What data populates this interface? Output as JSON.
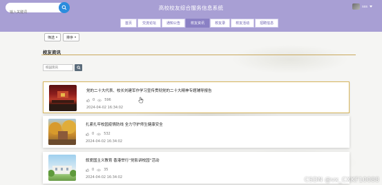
{
  "header": {
    "search_placeholder": "输入关键词",
    "site_title": "高校校友综合服务信息系统",
    "user_name": "sss"
  },
  "nav": {
    "items": [
      {
        "label": "首页",
        "active": false
      },
      {
        "label": "交流论坛",
        "active": false
      },
      {
        "label": "通知公告",
        "active": false
      },
      {
        "label": "校友资讯",
        "active": true
      },
      {
        "label": "校友录",
        "active": false
      },
      {
        "label": "校友活动",
        "active": false
      },
      {
        "label": "招聘信息",
        "active": false
      }
    ]
  },
  "filters": {
    "filter_label": "筛选",
    "sort_label": "排序"
  },
  "section": {
    "title": "校友资讯",
    "search_placeholder": "校园资讯"
  },
  "news": [
    {
      "title": "党的二十大代表、校长刘建军作学习宣传贯彻党的二十大精神专题辅导报告",
      "likes": "0",
      "views": "596",
      "date": "2024-04-02 16:34:02"
    },
    {
      "title": "扎紧扎牢校园疫情防线 全力守护师生健康安全",
      "likes": "0",
      "views": "532",
      "date": "2024-04-02 16:34:02"
    },
    {
      "title": "叙爱国主义教育 香港举行“党影讲校园”活动",
      "likes": "0",
      "views": "35",
      "date": "2024-04-02 16:34:02"
    }
  ],
  "watermark": "CSDN @vx_CXKF10088",
  "colors": {
    "header_bg": "#a89fd4",
    "nav_active": "#8a80c4",
    "accent_rule": "#c9a75a",
    "search_btn": "#2b8cdd"
  }
}
